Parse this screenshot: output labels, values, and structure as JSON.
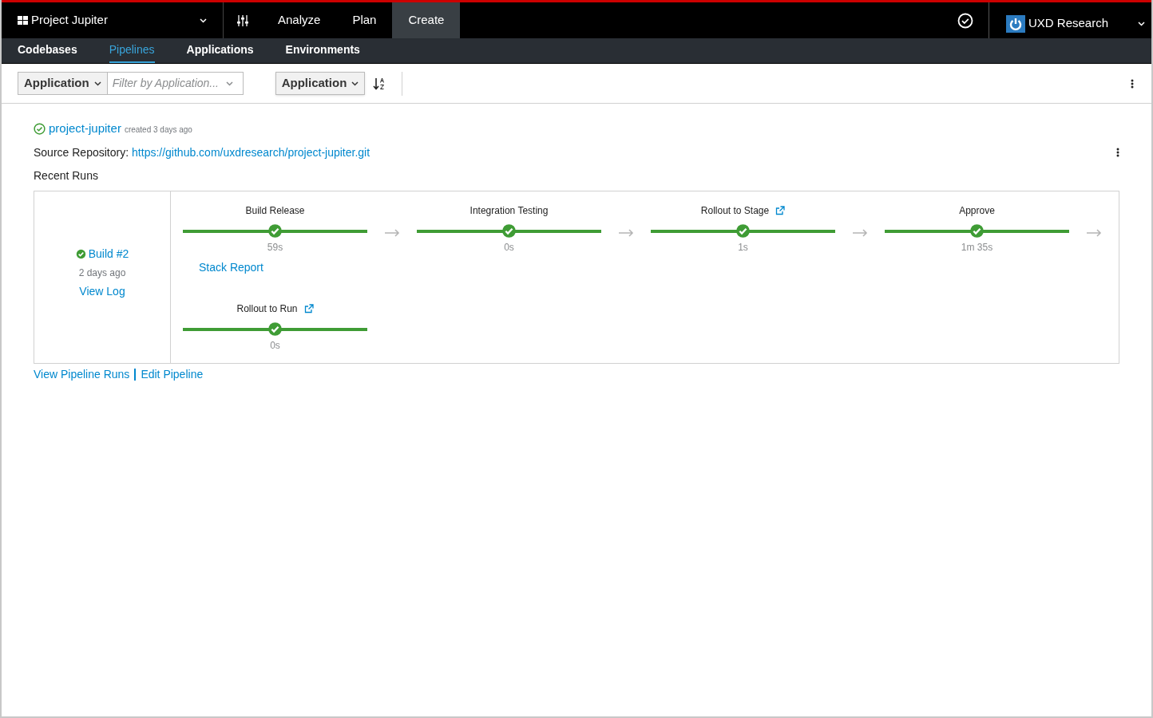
{
  "masthead": {
    "project": "Project Jupiter",
    "tabs": [
      {
        "label": "Analyze",
        "selected": false
      },
      {
        "label": "Plan",
        "selected": false
      },
      {
        "label": "Create",
        "selected": true
      }
    ],
    "user": "UXD Research"
  },
  "sub_nav": [
    {
      "label": "Codebases",
      "selected": false
    },
    {
      "label": "Pipelines",
      "selected": true
    },
    {
      "label": "Applications",
      "selected": false
    },
    {
      "label": "Environments",
      "selected": false
    }
  ],
  "toolbar": {
    "filter_field": "Application",
    "filter": {
      "placeholder": "Filter by Application..."
    },
    "sort_field": "Application"
  },
  "pipeline": {
    "name": "project-jupiter",
    "succeeded": true,
    "created": "created 3 days ago",
    "source_label": "Source Repository:",
    "source_url": "https://github.com/uxdresearch/project-jupiter.git",
    "recent_runs_label": "Recent Runs",
    "run": {
      "title": "Build #2",
      "succeeded": true,
      "time": "2 days ago",
      "link": "View Log"
    },
    "stage_rows": [
      [
        {
          "name": "Build Release",
          "succeeded": true,
          "level": 1,
          "duration": "59s",
          "external_link": false,
          "arrow_after": true,
          "link": "Stack Report"
        },
        {
          "name": "Integration Testing",
          "succeeded": true,
          "level": 1,
          "duration": "0s",
          "external_link": false,
          "arrow_after": true
        },
        {
          "name": "Rollout to Stage",
          "succeeded": true,
          "level": 1,
          "duration": "1s",
          "external_link": true,
          "arrow_after": true
        },
        {
          "name": "Approve",
          "succeeded": true,
          "level": 1,
          "duration": "1m 35s",
          "external_link": false,
          "arrow_after": true
        }
      ],
      [
        {
          "name": "Rollout to Run",
          "succeeded": true,
          "level": 1,
          "duration": "0s",
          "external_link": true,
          "arrow_after": false
        }
      ]
    ],
    "footer_links": [
      "View Pipeline Runs",
      "Edit Pipeline"
    ]
  }
}
